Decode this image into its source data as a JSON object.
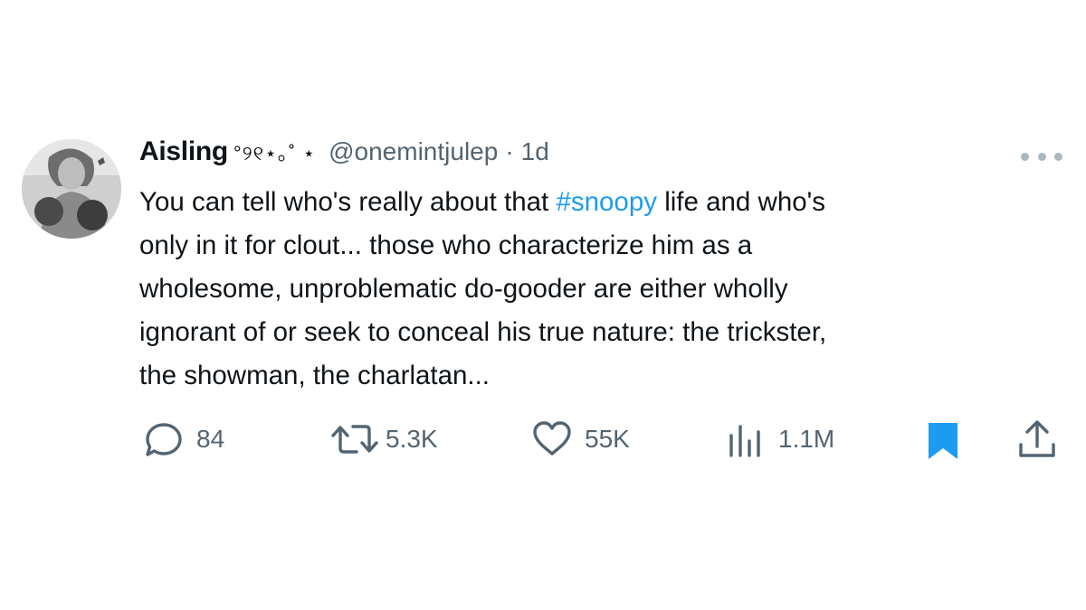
{
  "tweet": {
    "display_name": "Aisling",
    "name_decoration": "°୨୧⋆｡˚ ⋆",
    "handle": "@onemintjulep",
    "separator": "·",
    "time": "1d",
    "body_lines": [
      [
        "You can tell who's really about that ",
        "#snoopy",
        " life and who's"
      ],
      "only in it for clout... those who characterize him as a",
      "wholesome, unproblematic do-gooder are either wholly",
      "ignorant of or seek to conceal his true nature: the trickster,",
      "the showman, the charlatan..."
    ]
  },
  "actions": {
    "replies": "84",
    "reposts": "5.3K",
    "likes": "55K",
    "views": "1.1M"
  },
  "icons": {
    "reply": "reply-icon",
    "repost": "repost-icon",
    "like": "like-icon",
    "views": "views-icon",
    "bookmark": "bookmark-icon",
    "share": "share-icon",
    "more": "more-icon"
  },
  "colors": {
    "text": "#0f1419",
    "muted": "#536471",
    "accent": "#1d9bf0"
  }
}
